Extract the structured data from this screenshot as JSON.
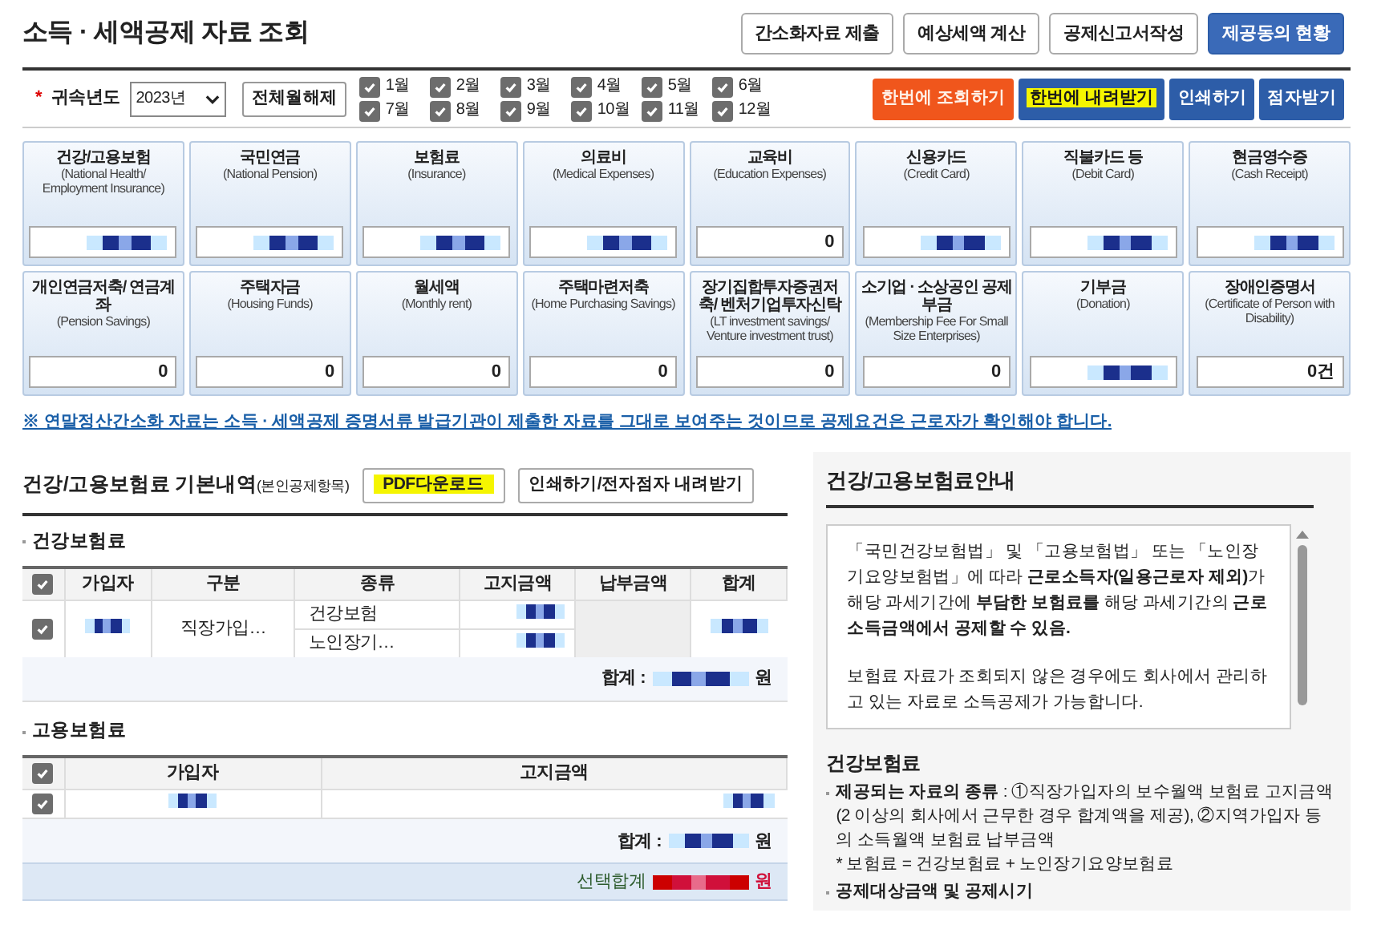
{
  "page_title": "소득 · 세액공제 자료 조회",
  "top_buttons": [
    {
      "label": "간소화자료 제출",
      "selected": false
    },
    {
      "label": "예상세액 계산",
      "selected": false
    },
    {
      "label": "공제신고서작성",
      "selected": false
    },
    {
      "label": "제공동의 현황",
      "selected": true
    }
  ],
  "filter": {
    "required_mark": "*",
    "year_label": "귀속년도",
    "year": "2023년",
    "toggle_all": "전체월해제",
    "months": [
      {
        "label": "1월",
        "checked": true
      },
      {
        "label": "2월",
        "checked": true
      },
      {
        "label": "3월",
        "checked": true
      },
      {
        "label": "4월",
        "checked": true
      },
      {
        "label": "5월",
        "checked": true
      },
      {
        "label": "6월",
        "checked": true
      },
      {
        "label": "7월",
        "checked": true
      },
      {
        "label": "8월",
        "checked": true
      },
      {
        "label": "9월",
        "checked": true
      },
      {
        "label": "10월",
        "checked": true
      },
      {
        "label": "11월",
        "checked": true
      },
      {
        "label": "12월",
        "checked": true
      }
    ],
    "actions": [
      {
        "label": "한번에 조회하기",
        "kind": "orange"
      },
      {
        "label": "한번에 내려받기",
        "kind": "highlighted"
      },
      {
        "label": "인쇄하기",
        "kind": "blue"
      },
      {
        "label": "점자받기",
        "kind": "blue"
      }
    ]
  },
  "categories": [
    {
      "title": "건강/고용보험",
      "subtitle": "(National Health/ Employment Insurance)",
      "kind": "masked"
    },
    {
      "title": "국민연금",
      "subtitle": "(National Pension)",
      "kind": "masked"
    },
    {
      "title": "보험료",
      "subtitle": "(Insurance)",
      "kind": "masked"
    },
    {
      "title": "의료비",
      "subtitle": "(Medical Expenses)",
      "kind": "masked"
    },
    {
      "title": "교육비",
      "subtitle": "(Education Expenses)",
      "kind": "amount",
      "value": "0"
    },
    {
      "title": "신용카드",
      "subtitle": "(Credit Card)",
      "kind": "masked"
    },
    {
      "title": "직불카드 등",
      "subtitle": "(Debit Card)",
      "kind": "masked"
    },
    {
      "title": "현금영수증",
      "subtitle": "(Cash Receipt)",
      "kind": "masked"
    },
    {
      "title": "개인연금저축/ 연금계좌",
      "subtitle": "(Pension Savings)",
      "kind": "amount",
      "value": "0"
    },
    {
      "title": "주택자금",
      "subtitle": "(Housing Funds)",
      "kind": "amount",
      "value": "0"
    },
    {
      "title": "월세액",
      "subtitle": "(Monthly rent)",
      "kind": "amount",
      "value": "0"
    },
    {
      "title": "주택마련저축",
      "subtitle": "(Home Purchasing Savings)",
      "kind": "amount",
      "value": "0"
    },
    {
      "title": "장기집합투자증권저축/ 벤처기업투자신탁",
      "subtitle": "(LT investment savings/ Venture investment trust)",
      "kind": "amount",
      "value": "0"
    },
    {
      "title": "소기업 · 소상공인 공제부금",
      "subtitle": "(Membership Fee For Small Size Enterprises)",
      "kind": "amount",
      "value": "0"
    },
    {
      "title": "기부금",
      "subtitle": "(Donation)",
      "kind": "masked"
    },
    {
      "title": "장애인증명서",
      "subtitle": "(Certificate of Person with Disability)",
      "kind": "amount",
      "value": "0건"
    }
  ],
  "notice": "※ 연말정산간소화 자료는 소득 · 세액공제 증명서류 발급기관이 제출한 자료를 그대로 보여주는 것이므로 공제요건은 근로자가 확인해야 합니다.",
  "detail": {
    "title": "건강/고용보험료 기본내역",
    "title_note": "(본인공제항목)",
    "buttons": [
      {
        "label": "PDF다운로드",
        "highlighted": true
      },
      {
        "label": "인쇄하기/전자점자 내려받기",
        "highlighted": false
      }
    ],
    "health": {
      "heading": "건강보험료",
      "select_all_checked": true,
      "columns": [
        "가입자",
        "구분",
        "종류",
        "고지금액",
        "납부금액",
        "합계"
      ],
      "rows": [
        {
          "checked": true,
          "group": "직장가입…",
          "kinds": [
            "건강보험",
            "노인장기…"
          ]
        }
      ],
      "total_label": "합계 :",
      "unit": "원"
    },
    "employment": {
      "heading": "고용보험료",
      "select_all_checked": true,
      "columns": [
        "가입자",
        "고지금액"
      ],
      "rows": [
        {
          "checked": true
        }
      ],
      "total_label": "합계 :",
      "unit": "원",
      "selected_total_label": "선택합계",
      "selected_unit": "원"
    }
  },
  "guide": {
    "title": "건강/고용보험료안내",
    "paragraphs": [
      "「국민건강보험법」 및 「고용보험법」 또는 「노인장기요양보험법」에 따라 **근로소득자(일용근로자 제외)**가 해당 과세기간에 **부담한 보험료를** 해당 과세기간의 **근로소득금액에서 공제할 수 있음.**",
      "보험료 자료가 조회되지 않은 경우에도 회사에서 관리하고 있는 자료로 소득공제가 가능합니다."
    ],
    "section": "건강보험료",
    "bullets": [
      {
        "text": "**제공되는 자료의 종류** : ①직장가입자의 보수월액 보험료 고지금액(2 이상의 회사에서 근무한 경우 합계액을 제공), ②지역가입자 등의 소득월액 보험료 납부금액",
        "note": "* 보험료 = 건강보험료 + 노인장기요양보험료"
      },
      {
        "text": "**공제대상금액 및 공제시기**"
      }
    ]
  }
}
